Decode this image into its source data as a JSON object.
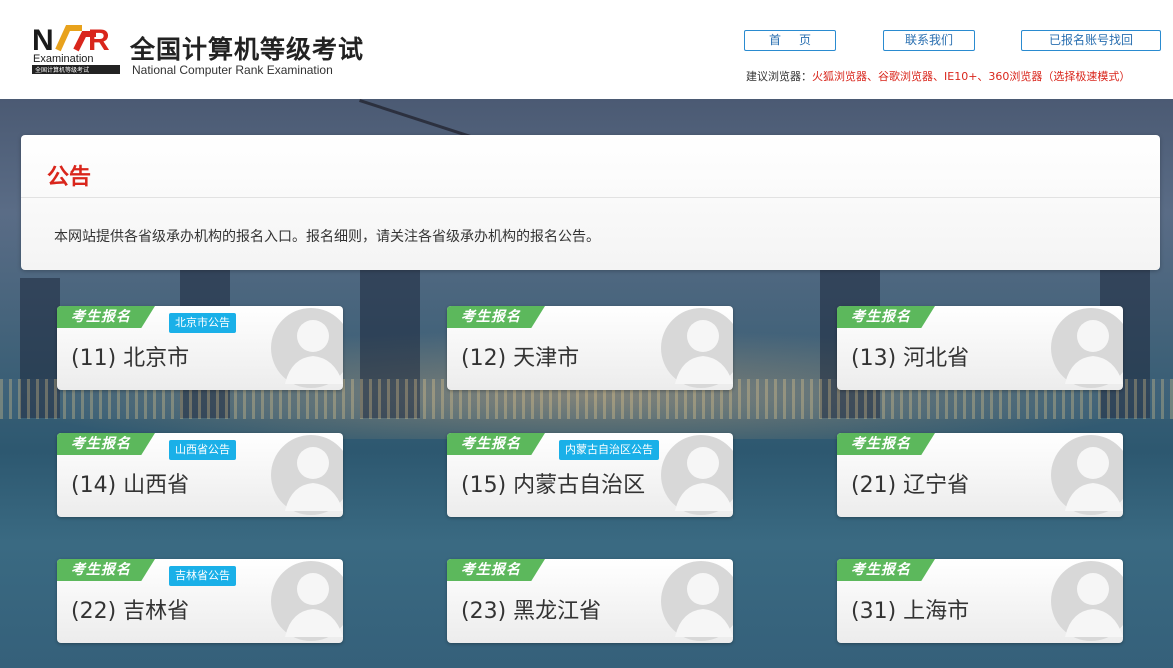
{
  "header": {
    "logo_title": "全国计算机等级考试",
    "logo_subtitle": "National Computer Rank Examination",
    "logo_mark_text": "NCR",
    "logo_examination": "Examination",
    "logo_small": "全国计算机等级考试",
    "nav": {
      "home": "首页",
      "contact": "联系我们",
      "recover": "已报名账号找回"
    },
    "browser_tip_label": "建议浏览器：",
    "browser_tip_list": "火狐浏览器、谷歌浏览器、IE10+、360浏览器（选择极速模式）"
  },
  "notice": {
    "title": "公告",
    "text": "本网站提供各省级承办机构的报名入口。报名细则，请关注各省级承办机构的报名公告。"
  },
  "cards": [
    {
      "tag": "考生报名",
      "name": "(11) 北京市",
      "notice": "北京市公告"
    },
    {
      "tag": "考生报名",
      "name": "(12) 天津市",
      "notice": ""
    },
    {
      "tag": "考生报名",
      "name": "(13) 河北省",
      "notice": ""
    },
    {
      "tag": "考生报名",
      "name": "(14) 山西省",
      "notice": "山西省公告"
    },
    {
      "tag": "考生报名",
      "name": "(15) 内蒙古自治区",
      "notice": "内蒙古自治区公告"
    },
    {
      "tag": "考生报名",
      "name": "(21) 辽宁省",
      "notice": ""
    },
    {
      "tag": "考生报名",
      "name": "(22) 吉林省",
      "notice": "吉林省公告"
    },
    {
      "tag": "考生报名",
      "name": "(23) 黑龙江省",
      "notice": ""
    },
    {
      "tag": "考生报名",
      "name": "(31) 上海市",
      "notice": ""
    }
  ],
  "colors": {
    "accent_red": "#d9261c",
    "tag_green": "#5cb85c",
    "notice_blue": "#1ab0e8",
    "nav_border": "#2a8bd0"
  },
  "icons": {
    "avatar": "user-avatar-icon",
    "logo": "ncr-logo-icon"
  }
}
